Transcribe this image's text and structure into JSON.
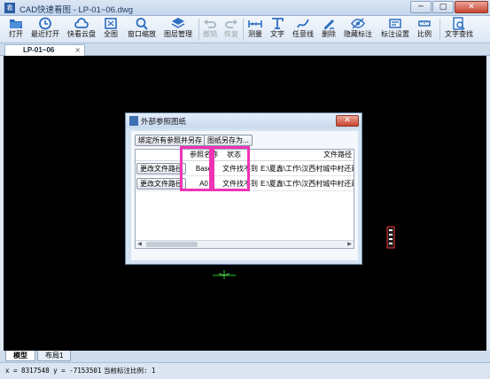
{
  "window": {
    "title": "CAD快速看图 - LP-01~06.dwg",
    "app_icon": "看",
    "minimize": "─",
    "maximize": "□",
    "close": "✕"
  },
  "toolbar": {
    "items": [
      {
        "label": "打开",
        "icon": "folder-open-icon",
        "enabled": true
      },
      {
        "label": "最近打开",
        "icon": "history-icon",
        "enabled": true
      },
      {
        "label": "快看云盘",
        "icon": "cloud-icon",
        "enabled": true
      },
      {
        "label": "全图",
        "icon": "full-extent-icon",
        "enabled": true
      },
      {
        "label": "窗口缩放",
        "icon": "window-zoom-icon",
        "enabled": true
      },
      {
        "label": "图层管理",
        "icon": "layers-icon",
        "enabled": true
      },
      {
        "label": "撤销",
        "icon": "undo-icon",
        "enabled": false
      },
      {
        "label": "恢复",
        "icon": "redo-icon",
        "enabled": false
      },
      {
        "label": "测量",
        "icon": "measure-icon",
        "enabled": true
      },
      {
        "label": "文字",
        "icon": "text-icon",
        "enabled": true
      },
      {
        "label": "任意线",
        "icon": "freeline-icon",
        "enabled": true
      },
      {
        "label": "删除",
        "icon": "delete-icon",
        "enabled": true
      },
      {
        "label": "隐藏标注",
        "icon": "hide-annotation-icon",
        "enabled": true
      },
      {
        "label": "标注设置",
        "icon": "annotation-settings-icon",
        "enabled": true
      },
      {
        "label": "比例",
        "icon": "scale-icon",
        "enabled": true
      },
      {
        "label": "文字查找",
        "icon": "text-search-icon",
        "enabled": true
      }
    ]
  },
  "document_tab": {
    "label": "LP-01~06",
    "close": "×"
  },
  "dialog": {
    "title": "外部参照图纸",
    "close": "✕",
    "bind_all_button": "绑定所有参照并另存",
    "save_as_button": "图纸另存为...",
    "columns": [
      "参照名称",
      "状态",
      "文件路径"
    ],
    "rows": [
      {
        "button": "更改文件路径",
        "name": "Base",
        "status": "文件找不到",
        "path": "E:\\夏鑫\\工作\\汉西村城中村还建小区"
      },
      {
        "button": "更改文件路径",
        "name": "A0",
        "status": "文件找不到",
        "path": "E:\\夏鑫\\工作\\汉西村城中村还建小区"
      }
    ]
  },
  "layout_tabs": [
    "模型",
    "布局1"
  ],
  "status": {
    "coords": "x = 8317548 y = -7153501",
    "scale": "当前标注比例: 1"
  },
  "colors": {
    "canvas": "#000000",
    "highlight": "#f033b5",
    "accent": "#2b5ea7"
  }
}
